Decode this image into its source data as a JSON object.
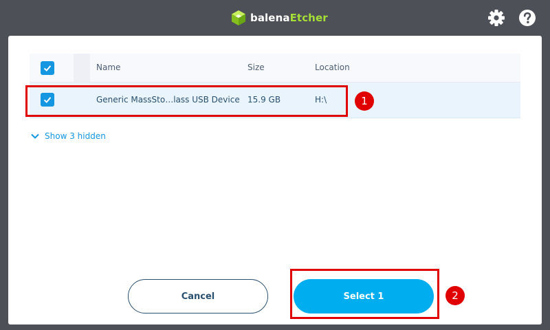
{
  "app": {
    "logo_primary": "balena",
    "logo_secondary": "Etcher",
    "logo_color": "#a5de37",
    "settings_icon": "gear-icon",
    "help_icon": "question-icon"
  },
  "table": {
    "columns": [
      "Name",
      "Size",
      "Location"
    ],
    "rows": [
      {
        "name": "Generic MassSto…lass USB Device",
        "size": "15.9 GB",
        "location": "H:\\",
        "selected": true
      }
    ],
    "all_selected": true
  },
  "show_hidden": {
    "label": "Show 3 hidden",
    "icon": "chevron-down-icon"
  },
  "buttons": {
    "cancel": "Cancel",
    "select": "Select 1"
  },
  "annotations": [
    "1",
    "2"
  ],
  "colors": {
    "accent": "#00aeef",
    "checkbox": "#1496e1",
    "annotation": "#e00000",
    "background": "#4d5057"
  }
}
